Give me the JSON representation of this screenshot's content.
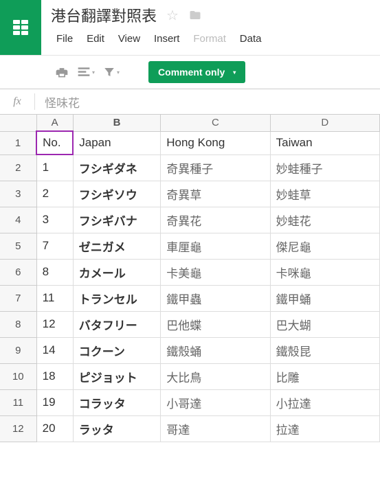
{
  "doc_title": "港台翻譯對照表",
  "menu": [
    "File",
    "Edit",
    "View",
    "Insert",
    "Format",
    "Data"
  ],
  "comment_btn": "Comment only",
  "fx_value": "怪味花",
  "columns": [
    "A",
    "B",
    "C",
    "D"
  ],
  "headers": {
    "no": "No.",
    "japan": "Japan",
    "hk": "Hong Kong",
    "tw": "Taiwan"
  },
  "rows": [
    {
      "n": "1",
      "no": "1",
      "jp": "フシギダネ",
      "hk": "奇異種子",
      "tw": "妙蛙種子"
    },
    {
      "n": "2",
      "no": "2",
      "jp": "フシギソウ",
      "hk": "奇異草",
      "tw": "妙蛙草"
    },
    {
      "n": "3",
      "no": "3",
      "jp": "フシギバナ",
      "hk": "奇異花",
      "tw": "妙蛙花"
    },
    {
      "n": "4",
      "no": "7",
      "jp": "ゼニガメ",
      "hk": "車厘龜",
      "tw": "傑尼龜"
    },
    {
      "n": "5",
      "no": "8",
      "jp": "カメール",
      "hk": "卡美龜",
      "tw": "卡咪龜"
    },
    {
      "n": "6",
      "no": "11",
      "jp": "トランセル",
      "hk": "鐵甲蟲",
      "tw": "鐵甲蛹"
    },
    {
      "n": "7",
      "no": "12",
      "jp": "バタフリー",
      "hk": "巴他蝶",
      "tw": "巴大蝴"
    },
    {
      "n": "8",
      "no": "14",
      "jp": "コクーン",
      "hk": "鐵殼蛹",
      "tw": "鐵殼昆"
    },
    {
      "n": "9",
      "no": "18",
      "jp": "ピジョット",
      "hk": "大比鳥",
      "tw": "比雕"
    },
    {
      "n": "10",
      "no": "19",
      "jp": "コラッタ",
      "hk": "小哥達",
      "tw": "小拉達"
    },
    {
      "n": "11",
      "no": "20",
      "jp": "ラッタ",
      "hk": "哥達",
      "tw": "拉達"
    }
  ]
}
